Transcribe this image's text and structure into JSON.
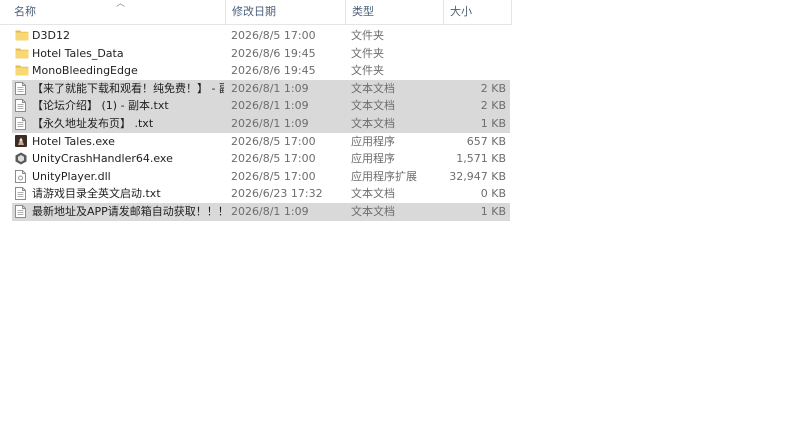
{
  "columns": {
    "name": "名称",
    "date": "修改日期",
    "type": "类型",
    "size": "大小"
  },
  "files": [
    {
      "name": "D3D12",
      "date": "2026/8/5 17:00",
      "type": "文件夹",
      "size": "",
      "icon": "folder-icon",
      "selected": false
    },
    {
      "name": "Hotel Tales_Data",
      "date": "2026/8/6 19:45",
      "type": "文件夹",
      "size": "",
      "icon": "folder-icon",
      "selected": false
    },
    {
      "name": "MonoBleedingEdge",
      "date": "2026/8/6 19:45",
      "type": "文件夹",
      "size": "",
      "icon": "folder-icon",
      "selected": false
    },
    {
      "name": "【来了就能下载和观看！纯免费！】 - 副...",
      "date": "2026/8/1 1:09",
      "type": "文本文档",
      "size": "2 KB",
      "icon": "text-file-icon",
      "selected": true
    },
    {
      "name": "【论坛介绍】 (1) - 副本.txt",
      "date": "2026/8/1 1:09",
      "type": "文本文档",
      "size": "2 KB",
      "icon": "text-file-icon",
      "selected": true
    },
    {
      "name": "【永久地址发布页】 .txt",
      "date": "2026/8/1 1:09",
      "type": "文本文档",
      "size": "1 KB",
      "icon": "text-file-icon",
      "selected": true
    },
    {
      "name": "Hotel Tales.exe",
      "date": "2026/8/5 17:00",
      "type": "应用程序",
      "size": "657 KB",
      "icon": "game-app-icon",
      "selected": false
    },
    {
      "name": "UnityCrashHandler64.exe",
      "date": "2026/8/5 17:00",
      "type": "应用程序",
      "size": "1,571 KB",
      "icon": "unity-app-icon",
      "selected": false
    },
    {
      "name": "UnityPlayer.dll",
      "date": "2026/8/5 17:00",
      "type": "应用程序扩展",
      "size": "32,947 KB",
      "icon": "dll-file-icon",
      "selected": false
    },
    {
      "name": "请游戏目录全英文启动.txt",
      "date": "2026/6/23 17:32",
      "type": "文本文档",
      "size": "0 KB",
      "icon": "text-file-icon",
      "selected": false
    },
    {
      "name": "最新地址及APP请发邮箱自动获取！！！...",
      "date": "2026/8/1 1:09",
      "type": "文本文档",
      "size": "1 KB",
      "icon": "text-file-icon",
      "selected": true
    }
  ],
  "colors": {
    "folder": "#f8d775",
    "folder_dark": "#e8b84a",
    "selection": "#d9d9d9",
    "header_text": "#4c607a"
  }
}
